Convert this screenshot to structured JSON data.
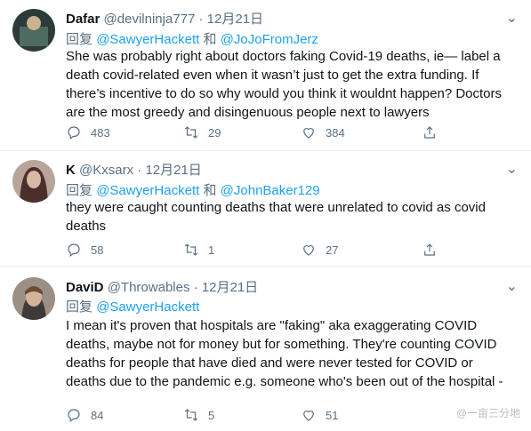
{
  "tweets": [
    {
      "name": "Dafar",
      "handle": "@devilninja777",
      "dot": "·",
      "date": "12月21日",
      "reply_prefix": "回复",
      "reply_to": [
        "@SawyerHackett",
        "和",
        "@JoJoFromJerz"
      ],
      "text": "She was probably right about doctors faking Covid-19 deaths, ie— label a death covid-related even when it wasn’t just to get the extra funding. If there’s incentive to do so why would you think it wouldnt happen? Doctors are the most greedy and disingenuous people next to lawyers",
      "replies": "483",
      "retweets": "29",
      "likes": "384",
      "avatar_color": "#2d3a3a"
    },
    {
      "name": "K",
      "handle": "@Kxsarx",
      "dot": "·",
      "date": "12月21日",
      "reply_prefix": "回复",
      "reply_to": [
        "@SawyerHackett",
        "和",
        "@JohnBaker129"
      ],
      "text": "they were caught counting deaths that were unrelated to covid as covid deaths",
      "replies": "58",
      "retweets": "1",
      "likes": "27",
      "avatar_color": "#7a5a4e"
    },
    {
      "name": "DaviD",
      "handle": "@Throwables",
      "dot": "·",
      "date": "12月21日",
      "reply_prefix": "回复",
      "reply_to": [
        "@SawyerHackett"
      ],
      "text": "I mean it's proven that hospitals are \"faking\" aka exaggerating COVID deaths, maybe not for money but for something. They're counting COVID deaths for people that have died and were never tested for COVID or deaths due to the pandemic e.g. someone who's been out of the hospital -",
      "replies": "84",
      "retweets": "5",
      "likes": "51",
      "avatar_color": "#8a6b58"
    }
  ],
  "icons": [
    "chevron-down-icon",
    "reply-icon",
    "retweet-icon",
    "like-icon",
    "share-icon"
  ],
  "watermark": "@一亩三分地",
  "colors": {
    "link": "#1da1f2",
    "muted": "#5b7083",
    "divider": "#e6ecf0"
  }
}
